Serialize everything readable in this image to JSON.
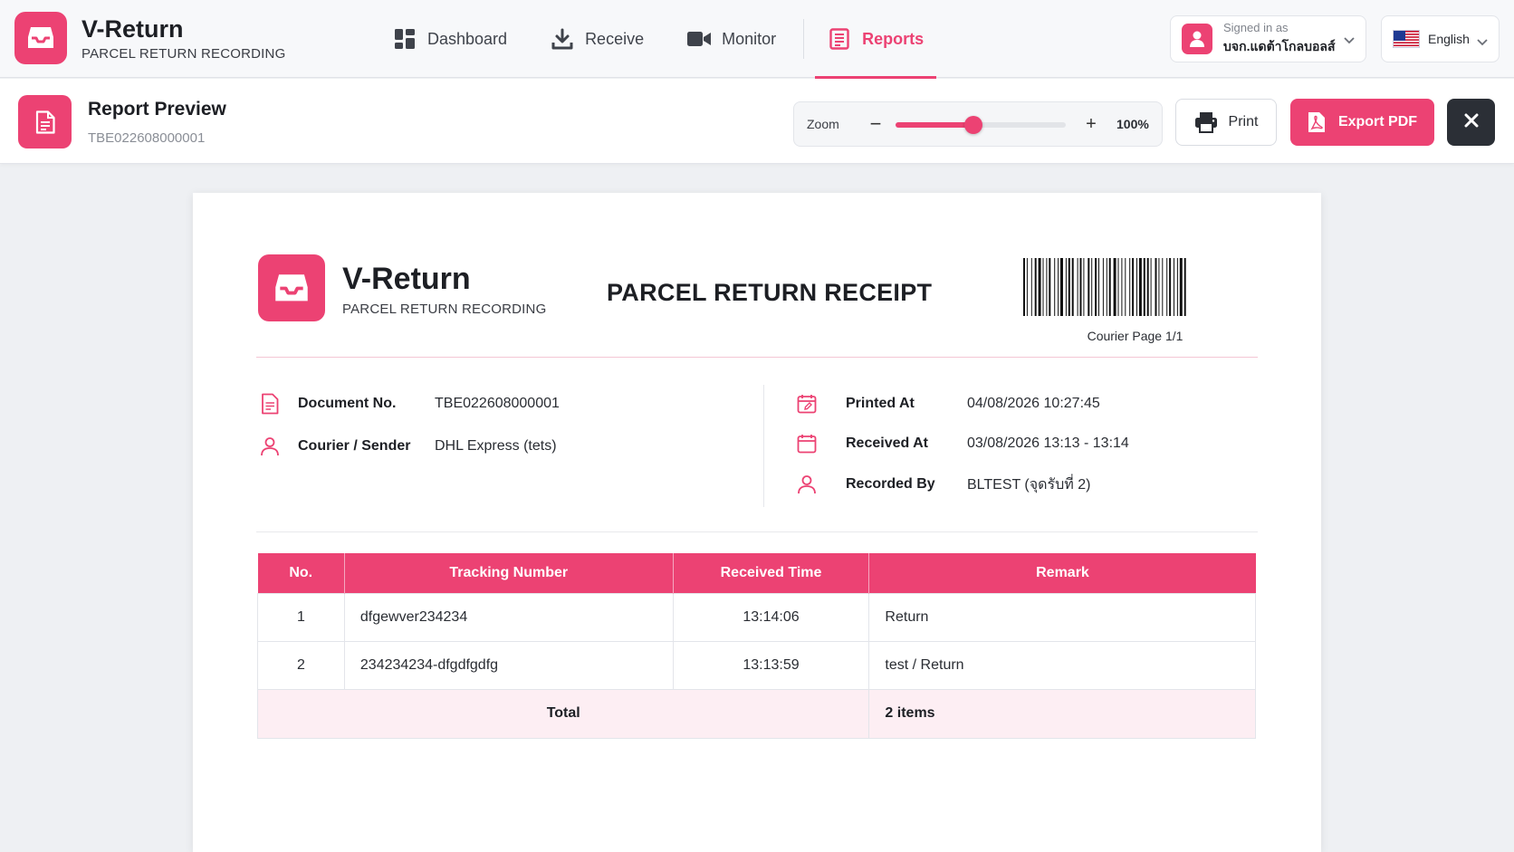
{
  "app": {
    "name": "V-Return",
    "subtitle": "PARCEL RETURN RECORDING"
  },
  "nav": [
    {
      "label": "Dashboard",
      "icon": "dashboard-icon"
    },
    {
      "label": "Receive",
      "icon": "download-icon"
    },
    {
      "label": "Monitor",
      "icon": "video-camera-icon"
    },
    {
      "label": "Reports",
      "icon": "report-icon",
      "active": true
    }
  ],
  "account": {
    "label": "Signed in as",
    "name": "บจก.แดต้าโกลบอลส์"
  },
  "language": {
    "label": "English",
    "flag": "flag-us-icon"
  },
  "toolbar": {
    "title": "Report Preview",
    "doc_id": "TBE022608000001",
    "zoom_label": "Zoom",
    "zoom_minus": "−",
    "zoom_plus": "+",
    "zoom_value": "100%",
    "zoom_fraction": 0.46,
    "print_label": "Print",
    "export_label": "Export PDF"
  },
  "document": {
    "brand": "V-Return",
    "brand_sub": "PARCEL RETURN RECORDING",
    "title": "PARCEL RETURN RECEIPT",
    "barcode_caption": "Courier Page 1/1",
    "left_fields": [
      {
        "label": "Document No.",
        "value": "TBE022608000001",
        "icon": "document-icon"
      },
      {
        "label": "Courier / Sender",
        "value": "DHL Express (tets)",
        "icon": "user-icon"
      }
    ],
    "right_fields": [
      {
        "label": "Printed At",
        "value": "04/08/2026 10:27:45",
        "icon": "calendar-edit-icon"
      },
      {
        "label": "Received At",
        "value": "03/08/2026 13:13 - 13:14",
        "icon": "calendar-icon"
      },
      {
        "label": "Recorded By",
        "value": "BLTEST (จุดรับที่ 2)",
        "icon": "user-icon"
      }
    ],
    "table": {
      "headers": [
        "No.",
        "Tracking Number",
        "Received Time",
        "Remark"
      ],
      "rows": [
        [
          "1",
          "dfgewver234234",
          "13:14:06",
          "Return"
        ],
        [
          "2",
          "234234234-dfgdfgdfg",
          "13:13:59",
          "test / Return"
        ]
      ],
      "total_label": "Total",
      "total_value": "2 items"
    }
  },
  "colors": {
    "accent": "#ec4273",
    "dark": "#2b2f36",
    "total_row": "#fdeef3"
  }
}
